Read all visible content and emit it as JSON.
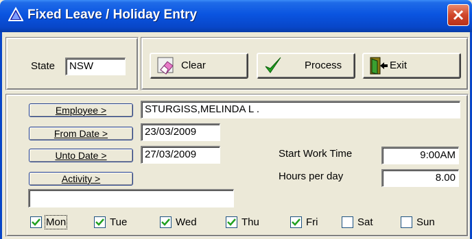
{
  "window": {
    "title": "Fixed Leave / Holiday Entry"
  },
  "state": {
    "label": "State",
    "value": "NSW"
  },
  "toolbar": {
    "clear_label": "Clear",
    "process_label": "Process",
    "exit_label": "Exit"
  },
  "form": {
    "employee_button": "Employee >",
    "employee_value": "STURGISS,MELINDA L .",
    "from_date_button": "From Date >",
    "from_date_value": "23/03/2009",
    "unto_date_button": "Unto Date >",
    "unto_date_value": "27/03/2009",
    "activity_button": "Activity >",
    "activity_value": "",
    "start_work_time_label": "Start Work Time",
    "start_work_time_value": "9:00AM",
    "hours_per_day_label": "Hours per day",
    "hours_per_day_value": "8.00"
  },
  "days": [
    {
      "label": "Mon",
      "checked": true
    },
    {
      "label": "Tue",
      "checked": true
    },
    {
      "label": "Wed",
      "checked": true
    },
    {
      "label": "Thu",
      "checked": true
    },
    {
      "label": "Fri",
      "checked": true
    },
    {
      "label": "Sat",
      "checked": false
    },
    {
      "label": "Sun",
      "checked": false
    }
  ],
  "colors": {
    "titlebar": "#0a54e0",
    "window_bg": "#ece9d8",
    "checkmark": "#21a121"
  }
}
